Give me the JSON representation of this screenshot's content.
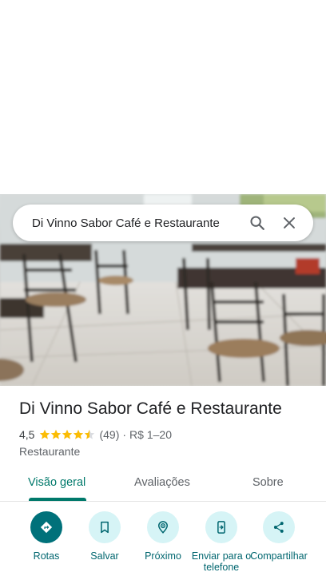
{
  "search": {
    "query": "Di Vinno Sabor Café e Restaurante"
  },
  "place": {
    "name": "Di Vinno Sabor Café e Restaurante",
    "rating": "4,5",
    "stars": 4.5,
    "reviews": "(49)",
    "separator": "·",
    "price": "R$ 1–20",
    "category": "Restaurante"
  },
  "tabs": [
    {
      "label": "Visão geral",
      "active": true
    },
    {
      "label": "Avaliações",
      "active": false
    },
    {
      "label": "Sobre",
      "active": false
    }
  ],
  "actions": [
    {
      "label": "Rotas",
      "icon": "directions-icon"
    },
    {
      "label": "Salvar",
      "icon": "bookmark-icon"
    },
    {
      "label": "Próximo",
      "icon": "nearby-icon"
    },
    {
      "label": "Enviar para o telefone",
      "icon": "send-to-phone-icon"
    },
    {
      "label": "Compartilhar",
      "icon": "share-icon"
    }
  ],
  "colors": {
    "accent": "#00796b",
    "action_bg": "#d6f4f6",
    "action_primary": "#00717a",
    "star": "#fbbc04"
  }
}
